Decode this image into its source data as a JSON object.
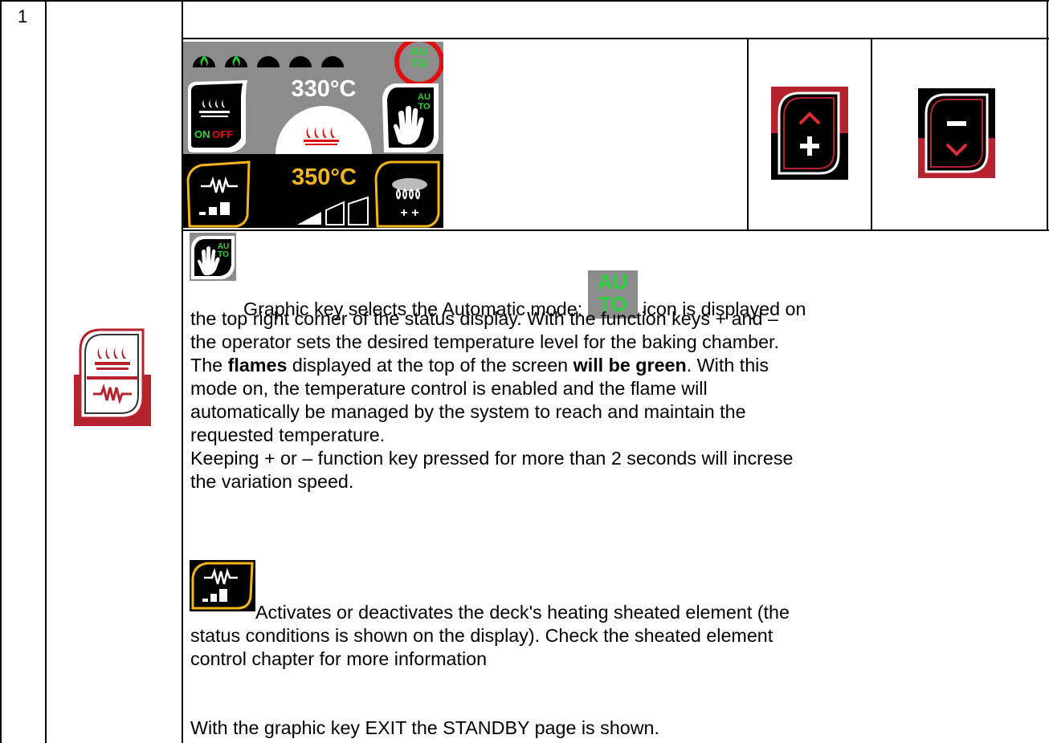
{
  "row_number": "1",
  "status_display": {
    "setpoint_temperature": "330°C",
    "real_temperature": "350°C",
    "flame_indicators": [
      "on",
      "on",
      "off",
      "off",
      "off"
    ],
    "auto_badge": {
      "line1": "AU",
      "line2": "TO"
    },
    "on_off_key": {
      "on": "ON",
      "off": "OFF"
    },
    "auto_key": {
      "line1": "AU",
      "line2": "TO"
    },
    "colors": {
      "flame_green": "#27d43a",
      "real_temp": "#f4b41c",
      "display_top": "#8c8c8c",
      "highlight_circle": "#e01010"
    }
  },
  "function_keys": {
    "plus_icon": "plus-arrow-up-icon",
    "minus_icon": "minus-arrow-down-icon"
  },
  "side_key_icon": "flame-heater-key-icon",
  "paragraph1": {
    "auto_icon": {
      "line1": "AU",
      "line2": "TO"
    },
    "line1_a": " Graphic key selects the Automatic mode: ",
    "line1_b": " icon is displayed on",
    "line2": "the top right corner of the status display. With the function keys + and –",
    "line3": "the operator sets the desired temperature level for the baking chamber.",
    "line4_a": "The ",
    "line4_bold1": "flames",
    "line4_b": " displayed at the top of the screen ",
    "line4_bold2": "will be green",
    "line4_c": ". With this",
    "line5": "mode on, the temperature control is enabled and the flame will",
    "line6": "automatically be managed by the system to reach and maintain the",
    "line7": "requested temperature.",
    "line8": "Keeping + or – function key pressed for more than 2 seconds will increse",
    "line9": "the variation speed."
  },
  "paragraph2": {
    "line1": "Activates or deactivates the deck's heating sheated element (the",
    "line2": "status conditions is shown on the display). Check the sheated element",
    "line3": "control chapter for more information"
  },
  "paragraph3": {
    "line1": "With the graphic key EXIT the STANDBY page is shown."
  }
}
